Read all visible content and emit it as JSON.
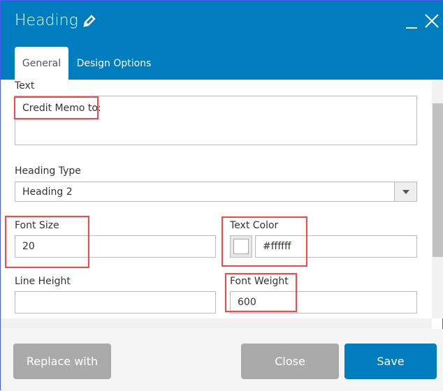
{
  "dialog": {
    "title": "Heading",
    "title_icon": "pencil-icon",
    "accent": "#007dbe"
  },
  "tabs": [
    {
      "label": "General",
      "active": true
    },
    {
      "label": "Design Options",
      "active": false
    }
  ],
  "fields": {
    "text": {
      "label": "Text",
      "value": "Credit Memo to:"
    },
    "heading_type": {
      "label": "Heading Type",
      "value": "Heading 2"
    },
    "font_size": {
      "label": "Font Size",
      "value": "20"
    },
    "text_color": {
      "label": "Text Color",
      "value": "#ffffff",
      "swatch": "#ffffff"
    },
    "line_height": {
      "label": "Line Height",
      "value": ""
    },
    "font_weight": {
      "label": "Font Weight",
      "value": "600"
    }
  },
  "footer": {
    "replace": "Replace with",
    "close": "Close",
    "save": "Save"
  },
  "highlight_color": "#ff4444"
}
